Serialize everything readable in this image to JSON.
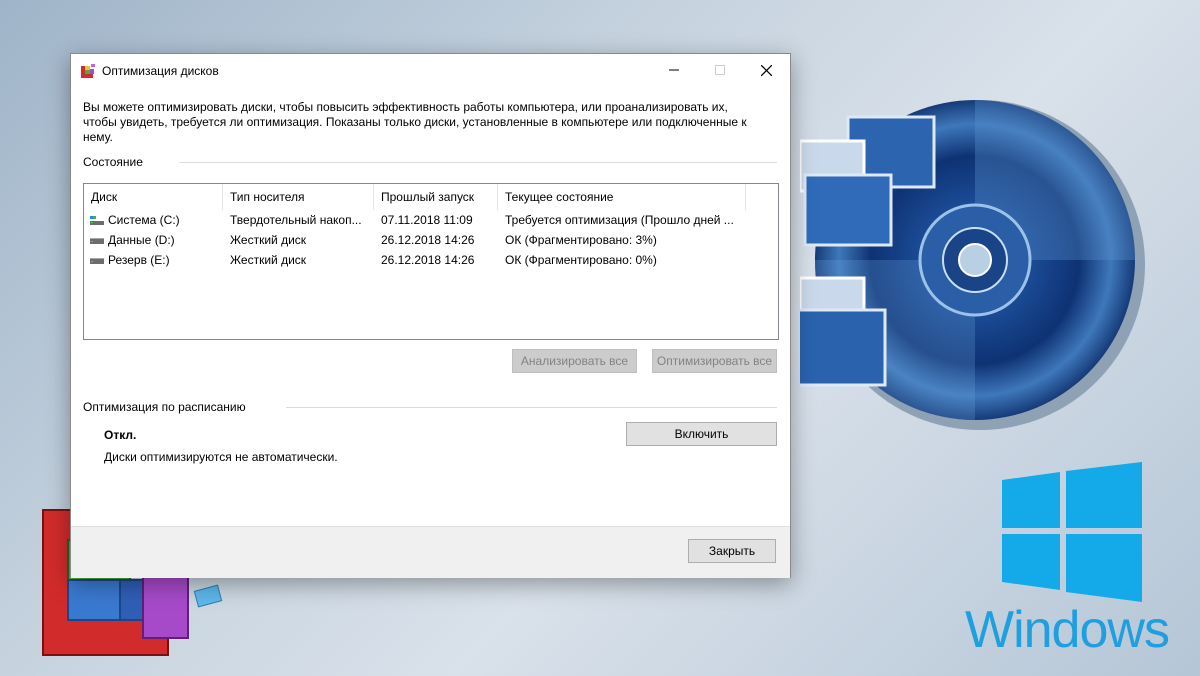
{
  "window": {
    "title": "Оптимизация дисков",
    "description": "Вы можете оптимизировать диски, чтобы повысить эффективность работы  компьютера, или проанализировать их, чтобы увидеть, требуется ли оптимизация. Показаны только диски, установленные в компьютере или подключенные к нему."
  },
  "status_section": {
    "label": "Состояние",
    "columns": [
      "Диск",
      "Тип носителя",
      "Прошлый запуск",
      "Текущее состояние"
    ],
    "rows": [
      {
        "disk": "Система (C:)",
        "media": "Твердотельный накоп...",
        "last_run": "07.11.2018 11:09",
        "state": "Требуется оптимизация (Прошло дней ...",
        "icon": "ssd-drive-icon"
      },
      {
        "disk": "Данные (D:)",
        "media": "Жесткий диск",
        "last_run": "26.12.2018 14:26",
        "state": "ОК (Фрагментировано: 3%)",
        "icon": "hdd-drive-icon"
      },
      {
        "disk": "Резерв (E:)",
        "media": "Жесткий диск",
        "last_run": "26.12.2018 14:26",
        "state": "ОК (Фрагментировано: 0%)",
        "icon": "hdd-drive-icon"
      }
    ],
    "analyze_all": "Анализировать все",
    "optimize_all": "Оптимизировать все"
  },
  "schedule_section": {
    "label": "Оптимизация по расписанию",
    "state": "Откл.",
    "description": "Диски оптимизируются не автоматически.",
    "enable_button": "Включить"
  },
  "footer": {
    "close_button": "Закрыть"
  },
  "background": {
    "brand_text": "Windows",
    "brand_color": "#1e9fe0"
  }
}
